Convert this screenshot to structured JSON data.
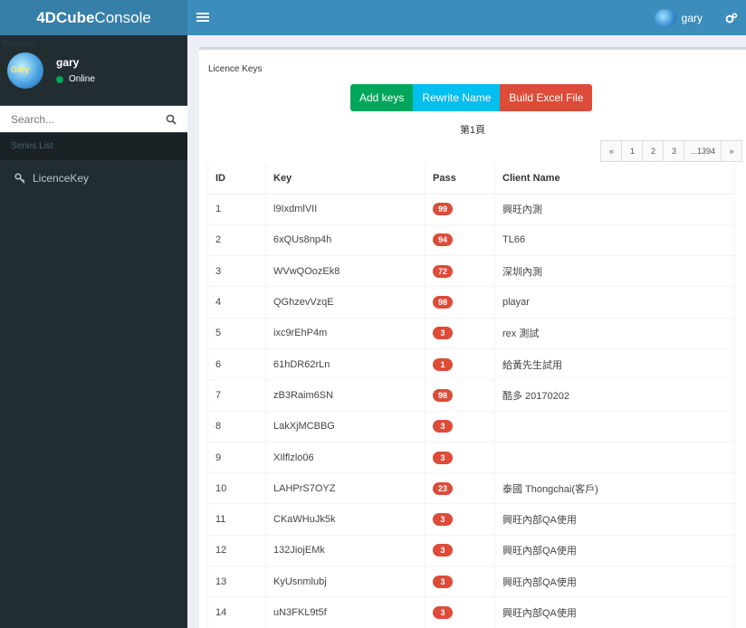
{
  "app": {
    "logo_bold": "4DCube",
    "logo_rest": "Console"
  },
  "navbar": {
    "user": "gary"
  },
  "sidebar": {
    "faint_text": "Software",
    "user": {
      "name": "gary",
      "status": "Online",
      "avatar_text": "Gary"
    },
    "search": {
      "placeholder": "Search..."
    },
    "header": "Series List",
    "items": [
      {
        "label": "LicenceKey"
      }
    ]
  },
  "main": {
    "box_title": "Licence Keys",
    "buttons": {
      "add": "Add keys",
      "rewrite": "Rewrite Name",
      "excel": "Build Excel File"
    },
    "page_label": "第1頁",
    "pagination": [
      "«",
      "1",
      "2",
      "3",
      "...1394",
      "»"
    ],
    "columns": [
      "ID",
      "Key",
      "Pass",
      "Client Name"
    ],
    "rows": [
      {
        "id": "1",
        "key": "l9IxdmlVII",
        "pass": "99",
        "client": "興旺內測"
      },
      {
        "id": "2",
        "key": "6xQUs8np4h",
        "pass": "94",
        "client": "TL66"
      },
      {
        "id": "3",
        "key": "WVwQOozEk8",
        "pass": "72",
        "client": "深圳內測"
      },
      {
        "id": "4",
        "key": "QGhzevVzqE",
        "pass": "98",
        "client": "playar"
      },
      {
        "id": "5",
        "key": "ixc9rEhP4m",
        "pass": "3",
        "client": "rex 測試"
      },
      {
        "id": "6",
        "key": "61hDR62rLn",
        "pass": "1",
        "client": "給黃先生試用"
      },
      {
        "id": "7",
        "key": "zB3Raim6SN",
        "pass": "98",
        "client": "酷多 20170202"
      },
      {
        "id": "8",
        "key": "LakXjMCBBG",
        "pass": "3",
        "client": ""
      },
      {
        "id": "9",
        "key": "XIlflzlo06",
        "pass": "3",
        "client": ""
      },
      {
        "id": "10",
        "key": "LAHPrS7OYZ",
        "pass": "23",
        "client": "泰國 Thongchai(客戶)"
      },
      {
        "id": "11",
        "key": "CKaWHuJk5k",
        "pass": "3",
        "client": "興旺內部QA使用"
      },
      {
        "id": "12",
        "key": "132JiojEMk",
        "pass": "3",
        "client": "興旺內部QA使用"
      },
      {
        "id": "13",
        "key": "KyUsnmlubj",
        "pass": "3",
        "client": "興旺內部QA使用"
      },
      {
        "id": "14",
        "key": "uN3FKL9t5f",
        "pass": "3",
        "client": "興旺內部QA使用"
      }
    ]
  },
  "colors": {
    "navbar": "#3c8dbc",
    "logo_bg": "#367fa9",
    "sidebar": "#222d32",
    "badge": "#dd4b39",
    "btn_green": "#00a65a",
    "btn_aqua": "#00c0ef",
    "btn_red": "#dd4b39"
  }
}
